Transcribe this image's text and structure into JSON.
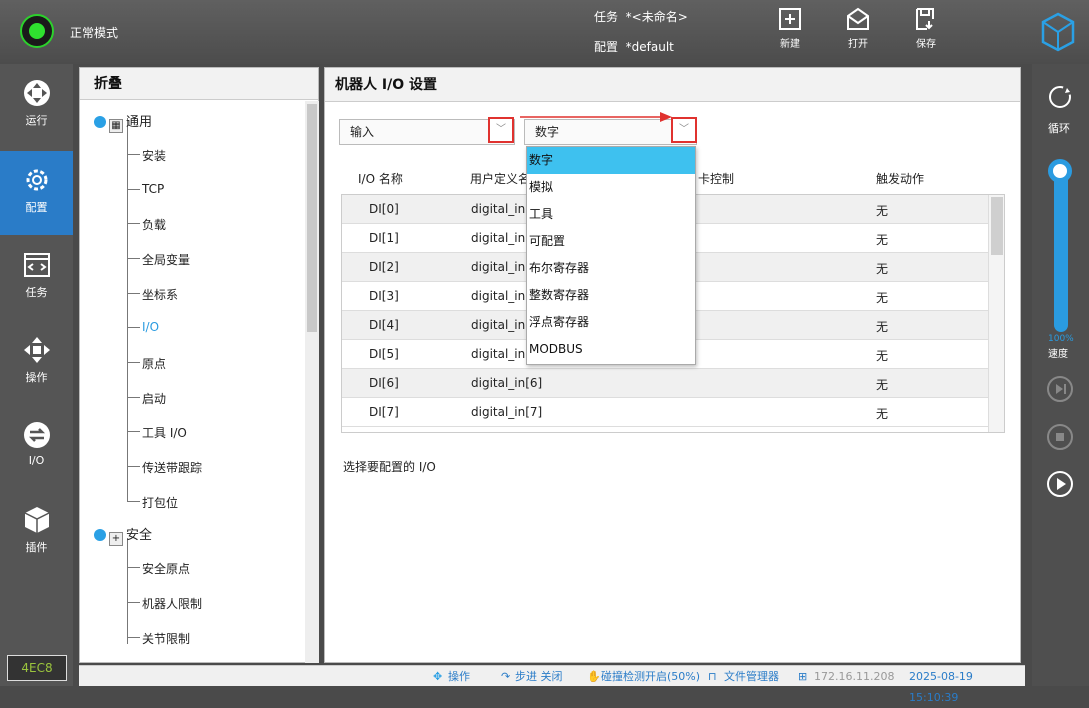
{
  "topbar": {
    "mode": "正常模式",
    "task_label": "任务",
    "task_value": "*<未命名>",
    "config_label": "配置",
    "config_value": "*default",
    "buttons": [
      {
        "label": "新建",
        "icon": "new-file-icon"
      },
      {
        "label": "打开",
        "icon": "open-envelope-icon"
      },
      {
        "label": "保存",
        "icon": "save-icon"
      }
    ]
  },
  "leftnav": {
    "items": [
      {
        "label": "运行",
        "icon": "run-icon"
      },
      {
        "label": "配置",
        "icon": "config-gear-icon"
      },
      {
        "label": "任务",
        "icon": "task-code-icon"
      },
      {
        "label": "操作",
        "icon": "move-arrows-icon"
      },
      {
        "label": "I/O",
        "icon": "io-arrows-icon"
      },
      {
        "label": "插件",
        "icon": "plugin-cube-icon"
      }
    ],
    "serial": "4EC8"
  },
  "rightnav": {
    "loop_label": "循环",
    "speed_value": "100%",
    "speed_label": "速度"
  },
  "tree": {
    "title": "折叠",
    "groups": [
      {
        "label": "通用",
        "items": [
          "安装",
          "TCP",
          "负载",
          "全局变量",
          "坐标系",
          "I/O",
          "原点",
          "启动",
          "工具 I/O",
          "传送带跟踪",
          "打包位"
        ]
      },
      {
        "label": "安全",
        "items": [
          "安全原点",
          "机器人限制",
          "关节限制"
        ]
      }
    ]
  },
  "main": {
    "title": "机器人 I/O 设置",
    "direction_value": "输入",
    "type_value": "数字",
    "columns": [
      "I/O 名称",
      "用户定义名",
      "卡控制",
      "触发动作"
    ],
    "rows": [
      {
        "name": "DI[0]",
        "user": "digital_in",
        "action": "无"
      },
      {
        "name": "DI[1]",
        "user": "digital_in",
        "action": "无"
      },
      {
        "name": "DI[2]",
        "user": "digital_in",
        "action": "无"
      },
      {
        "name": "DI[3]",
        "user": "digital_in",
        "action": "无"
      },
      {
        "name": "DI[4]",
        "user": "digital_in",
        "action": "无"
      },
      {
        "name": "DI[5]",
        "user": "digital_in",
        "action": "无"
      },
      {
        "name": "DI[6]",
        "user": "digital_in[6]",
        "action": "无"
      },
      {
        "name": "DI[7]",
        "user": "digital_in[7]",
        "action": "无"
      }
    ],
    "dropdown_options": [
      "数字",
      "模拟",
      "工具",
      "可配置",
      "布尔寄存器",
      "整数寄存器",
      "浮点寄存器",
      "MODBUS"
    ],
    "hint": "选择要配置的 I/O"
  },
  "statusbar": {
    "operation": "操作",
    "step": "步进 关闭",
    "collision": "碰撞检测开启(50%)",
    "file_manager": "文件管理器",
    "ip": "172.16.11.208",
    "datetime": "2025-08-19 15:10:39"
  },
  "colors": {
    "accent": "#2a7cc8",
    "highlight": "#3ec1ef",
    "annotation_red": "#e0322f",
    "status_green": "#2fe02f"
  }
}
